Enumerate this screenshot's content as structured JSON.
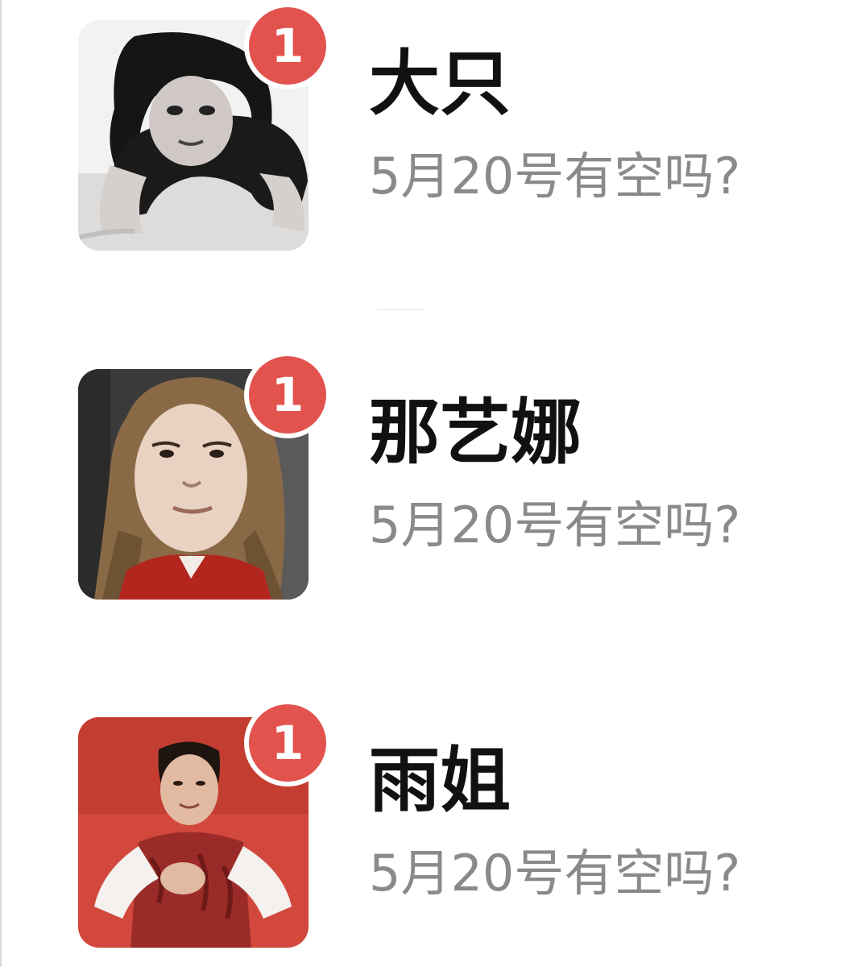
{
  "chats": [
    {
      "name": "大只",
      "preview": "5月20号有空吗?",
      "unread": "1",
      "avatar_icon": "person-crouching-avatar",
      "avatar_bg": "#e8e8e8"
    },
    {
      "name": "那艺娜",
      "preview": "5月20号有空吗?",
      "unread": "1",
      "avatar_icon": "woman-portrait-avatar",
      "avatar_bg": "#3b3b3b"
    },
    {
      "name": "雨姐",
      "preview": "5月20号有空吗?",
      "unread": "1",
      "avatar_icon": "woman-red-background-avatar",
      "avatar_bg": "#d2483c"
    }
  ],
  "colors": {
    "badge": "#e2534e",
    "name": "#111111",
    "preview": "#8a8a8a"
  }
}
